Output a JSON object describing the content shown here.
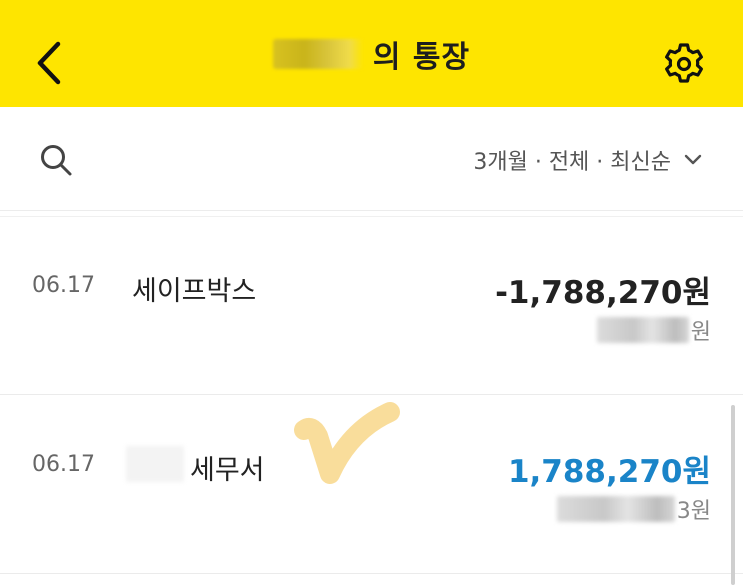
{
  "header": {
    "title": "의 통장",
    "back_icon": "chevron-left-icon",
    "settings_icon": "gear-icon",
    "bg_color": "#FEE500"
  },
  "filter_bar": {
    "search_icon": "search-icon",
    "filter_label": "3개월 · 전체 · 최신순",
    "dropdown_icon": "chevron-down-icon"
  },
  "transactions": [
    {
      "date": "06.17",
      "name": "세이프박스",
      "amount": "-1,788,270원",
      "balance_suffix": "원",
      "amount_color": "#222222"
    },
    {
      "date": "06.17",
      "name": "세무서",
      "amount": "1,788,270원",
      "balance_suffix": "3원",
      "amount_color": "#1a84c8"
    }
  ],
  "colors": {
    "deposit": "#1a84c8",
    "withdrawal": "#222222"
  }
}
